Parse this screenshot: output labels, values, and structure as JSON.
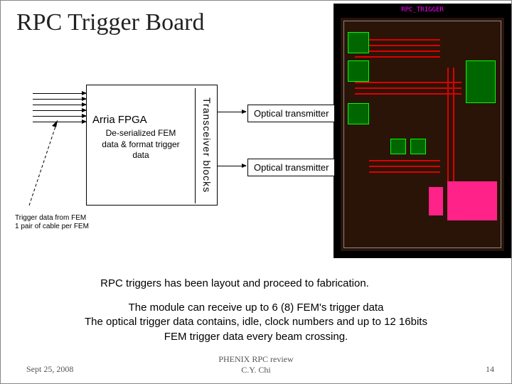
{
  "slide": {
    "title": "RPC Trigger Board"
  },
  "fpga": {
    "title": "Arria FPGA",
    "description": "De-serialized FEM data & format trigger data",
    "transceiver_label": "Transceiver blocks"
  },
  "optical": {
    "box1": "Optical transmitter",
    "box2": "Optical transmitter"
  },
  "trigger_caption": {
    "line1": "Trigger data from FEM",
    "line2": "1 pair of cable per FEM"
  },
  "body": {
    "line1": "RPC triggers has been layout and proceed to fabrication.",
    "para2": "The module can receive up to 6 (8) FEM's trigger data\nThe optical trigger data contains, idle, clock numbers and up to 12 16bits\nFEM trigger data every beam crossing."
  },
  "pcb": {
    "label": "RPC_TRIGGER"
  },
  "footer": {
    "date": "Sept 25, 2008",
    "center": "PHENIX RPC review\nC.Y. Chi",
    "page": "14"
  }
}
